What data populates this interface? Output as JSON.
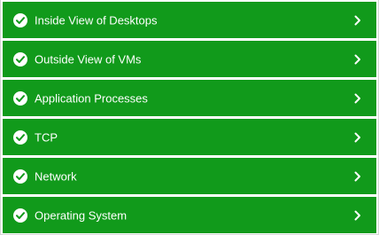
{
  "items": [
    {
      "label": "Inside View of Desktops",
      "status_icon": "check-circle-icon",
      "action_icon": "chevron-right-icon"
    },
    {
      "label": "Outside View of VMs",
      "status_icon": "check-circle-icon",
      "action_icon": "chevron-right-icon"
    },
    {
      "label": "Application Processes",
      "status_icon": "check-circle-icon",
      "action_icon": "chevron-right-icon"
    },
    {
      "label": "TCP",
      "status_icon": "check-circle-icon",
      "action_icon": "chevron-right-icon"
    },
    {
      "label": "Network",
      "status_icon": "check-circle-icon",
      "action_icon": "chevron-right-icon"
    },
    {
      "label": "Operating System",
      "status_icon": "check-circle-icon",
      "action_icon": "chevron-right-icon"
    }
  ],
  "colors": {
    "row_background": "#119a1b",
    "text": "#ffffff",
    "check_mark": "#119a1b"
  }
}
